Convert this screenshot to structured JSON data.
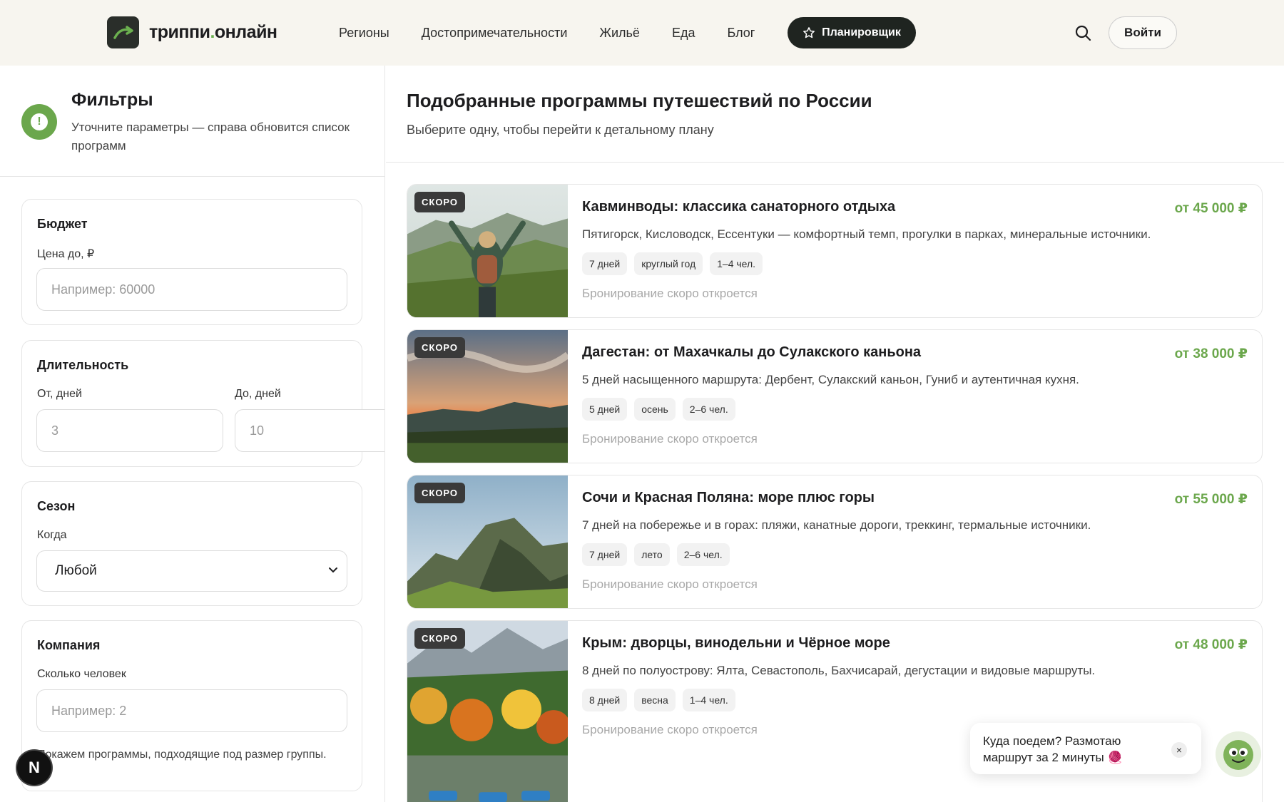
{
  "header": {
    "logo_main": "триппи",
    "logo_dot": ".",
    "logo_suffix": "онлайн",
    "nav": [
      "Регионы",
      "Достопримечательности",
      "Жильё",
      "Еда",
      "Блог"
    ],
    "planner_label": "Планировщик",
    "login_label": "Войти"
  },
  "sidebar": {
    "title": "Фильтры",
    "subtitle": "Уточните параметры — справа обновится список программ",
    "budget": {
      "title": "Бюджет",
      "label": "Цена до, ₽",
      "placeholder": "Например: 60000"
    },
    "duration": {
      "title": "Длительность",
      "from_label": "От, дней",
      "from_placeholder": "3",
      "to_label": "До, дней",
      "to_placeholder": "10"
    },
    "season": {
      "title": "Сезон",
      "label": "Когда",
      "value": "Любой"
    },
    "company": {
      "title": "Компания",
      "label": "Сколько человек",
      "placeholder": "Например: 2",
      "hint": "Покажем программы, подходящие под размер группы."
    }
  },
  "main": {
    "title": "Подобранные программы путешествий по России",
    "subtitle": "Выберите одну, чтобы перейти к детальному плану",
    "programs": [
      {
        "badge": "СКОРО",
        "title": "Кавминводы: классика санаторного отдыха",
        "price": "от 45 000 ₽",
        "desc": "Пятигорск, Кисловодск, Ессентуки — комфортный темп, прогулки в парках, минеральные источники.",
        "tags": [
          "7 дней",
          "круглый год",
          "1–4 чел."
        ],
        "note": "Бронирование скоро откроется"
      },
      {
        "badge": "СКОРО",
        "title": "Дагестан: от Махачкалы до Сулакского каньона",
        "price": "от 38 000 ₽",
        "desc": "5 дней насыщенного маршрута: Дербент, Сулакский каньон, Гуниб и аутентичная кухня.",
        "tags": [
          "5 дней",
          "осень",
          "2–6 чел."
        ],
        "note": "Бронирование скоро откроется"
      },
      {
        "badge": "СКОРО",
        "title": "Сочи и Красная Поляна: море плюс горы",
        "price": "от 55 000 ₽",
        "desc": "7 дней на побережье и в горах: пляжи, канатные дороги, треккинг, термальные источники.",
        "tags": [
          "7 дней",
          "лето",
          "2–6 чел."
        ],
        "note": "Бронирование скоро откроется"
      },
      {
        "badge": "СКОРО",
        "title": "Крым: дворцы, винодельни и Чёрное море",
        "price": "от 48 000 ₽",
        "desc": "8 дней по полуострову: Ялта, Севастополь, Бахчисарай, дегустации и видовые маршруты.",
        "tags": [
          "8 дней",
          "весна",
          "1–4 чел."
        ],
        "note": "Бронирование скоро откроется"
      }
    ]
  },
  "chat": {
    "text": "Куда поедем? Размотаю маршрут за 2 минуты 🧶",
    "close": "×"
  },
  "dev_badge": "N",
  "colors": {
    "accent_green": "#6ba74c",
    "dark": "#1f2420",
    "header_bg": "#f7f5ef"
  }
}
